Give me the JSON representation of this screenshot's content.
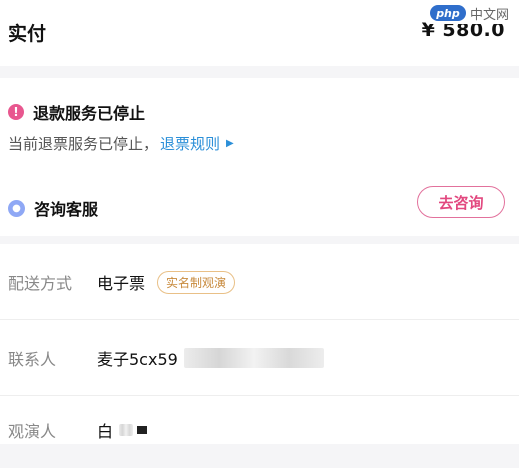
{
  "payment": {
    "label": "实付",
    "amount": "¥ 580.0"
  },
  "watermark": {
    "logo": "php",
    "text": "中文网"
  },
  "refund": {
    "title": "退款服务已停止",
    "description": "当前退票服务已停止，",
    "rules_link": "退票规则"
  },
  "consult": {
    "label": "咨询客服",
    "button": "去咨询"
  },
  "delivery": {
    "label": "配送方式",
    "value": "电子票",
    "tag": "实名制观演"
  },
  "contact": {
    "label": "联系人",
    "value": "麦子5cx59"
  },
  "audience": {
    "label": "观演人",
    "value": "白"
  },
  "colors": {
    "accent_pink": "#e2487f",
    "link_blue": "#2b8fd8",
    "tag_gold": "#c88a3c"
  },
  "icons": [
    "alert-icon",
    "chat-icon",
    "triangle-right-icon"
  ]
}
